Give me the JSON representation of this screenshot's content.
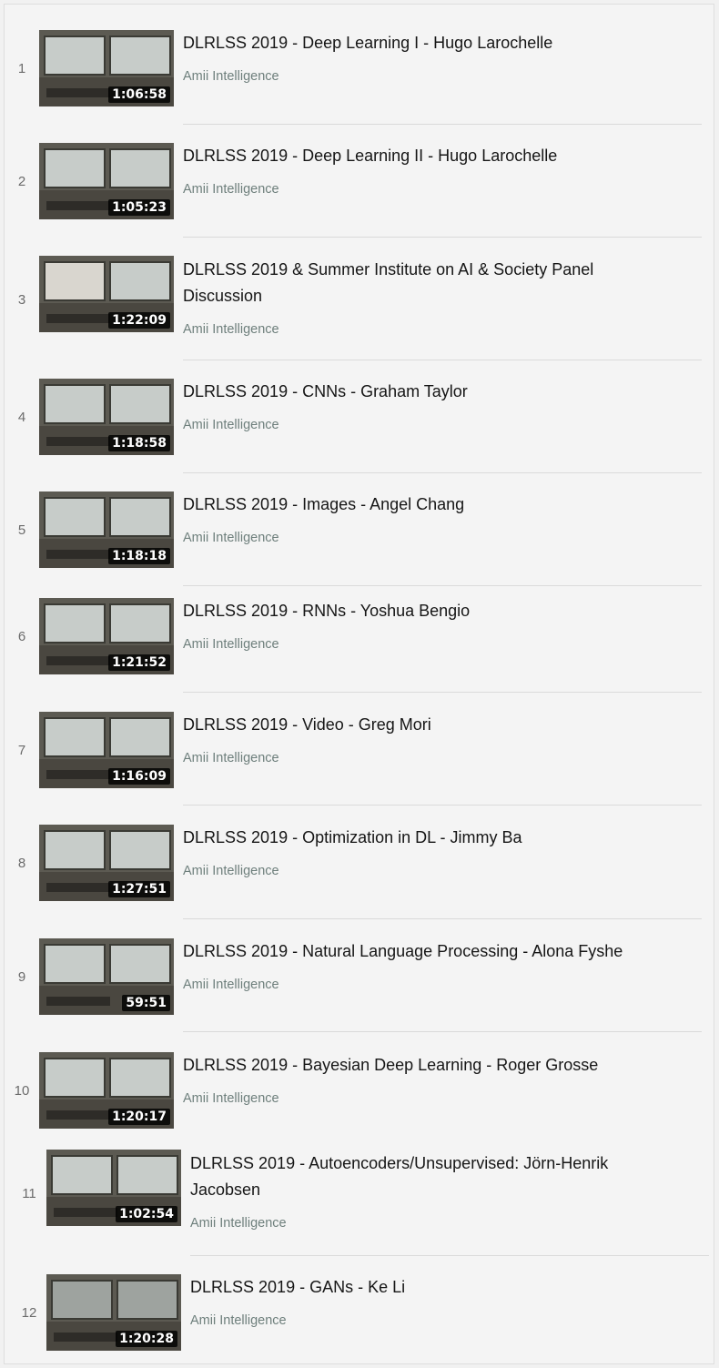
{
  "playlist": {
    "items": [
      {
        "index": "1",
        "title": "DLRLSS 2019 - Deep Learning I - Hugo Larochelle",
        "channel": "Amii Intelligence",
        "duration": "1:06:58"
      },
      {
        "index": "2",
        "title": "DLRLSS 2019 - Deep Learning II - Hugo Larochelle",
        "channel": "Amii Intelligence",
        "duration": "1:05:23"
      },
      {
        "index": "3",
        "title": "DLRLSS 2019 & Summer Institute on AI & Society Panel Discussion",
        "channel": "Amii Intelligence",
        "duration": "1:22:09"
      },
      {
        "index": "4",
        "title": "DLRLSS 2019 - CNNs - Graham Taylor",
        "channel": "Amii Intelligence",
        "duration": "1:18:58"
      },
      {
        "index": "5",
        "title": "DLRLSS 2019 - Images - Angel Chang",
        "channel": "Amii Intelligence",
        "duration": "1:18:18"
      },
      {
        "index": "6",
        "title": "DLRLSS 2019 - RNNs - Yoshua Bengio",
        "channel": "Amii Intelligence",
        "duration": "1:21:52"
      },
      {
        "index": "7",
        "title": "DLRLSS 2019 - Video - Greg Mori",
        "channel": "Amii Intelligence",
        "duration": "1:16:09"
      },
      {
        "index": "8",
        "title": "DLRLSS 2019 - Optimization in DL - Jimmy Ba",
        "channel": "Amii Intelligence",
        "duration": "1:27:51"
      },
      {
        "index": "9",
        "title": "DLRLSS 2019 - Natural Language Processing - Alona Fyshe",
        "channel": "Amii Intelligence",
        "duration": "59:51"
      },
      {
        "index": "10",
        "title": "DLRLSS 2019 - Bayesian Deep Learning - Roger Grosse",
        "channel": "Amii Intelligence",
        "duration": "1:20:17"
      },
      {
        "index": "11",
        "title": "DLRLSS 2019 - Autoencoders/Unsupervised: Jörn-Henrik Jacobsen",
        "channel": "Amii Intelligence",
        "duration": "1:02:54"
      },
      {
        "index": "12",
        "title": "DLRLSS 2019 - GANs - Ke Li",
        "channel": "Amii Intelligence",
        "duration": "1:20:28"
      }
    ]
  },
  "colors": {
    "background": "#f4f4f4",
    "title_text": "#161616",
    "channel_text": "#6e7f7c",
    "index_text": "#6b6b6b",
    "duration_badge": "#000000"
  }
}
